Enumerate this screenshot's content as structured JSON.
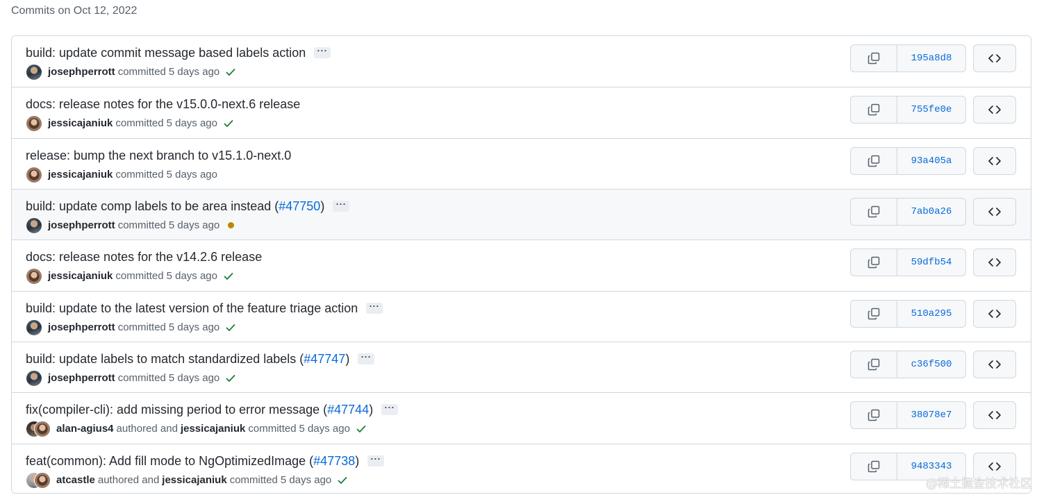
{
  "group_title": "Commits on Oct 12, 2022",
  "icons": {
    "copy": "copy-icon",
    "browse": "code-icon",
    "status_success": "check-icon",
    "status_pending": "pending-dot-icon",
    "more": "ellipsis-icon"
  },
  "colors": {
    "link": "#0969da",
    "success": "#1a7f37",
    "pending": "#bf8700",
    "border": "#d0d7de"
  },
  "commits": [
    {
      "title": "build: update commit message based labels action",
      "pr": "",
      "has_more": true,
      "author": "josephperrott",
      "coauthor": "",
      "authored_word": "",
      "committed_word": "committed",
      "time": "5 days ago",
      "status": "success",
      "sha": "195a8d8",
      "avatars": [
        "male"
      ]
    },
    {
      "title": "docs: release notes for the v15.0.0-next.6 release",
      "pr": "",
      "has_more": false,
      "author": "jessicajaniuk",
      "coauthor": "",
      "authored_word": "",
      "committed_word": "committed",
      "time": "5 days ago",
      "status": "success",
      "sha": "755fe0e",
      "avatars": [
        "female"
      ]
    },
    {
      "title": "release: bump the next branch to v15.1.0-next.0",
      "pr": "",
      "has_more": false,
      "author": "jessicajaniuk",
      "coauthor": "",
      "authored_word": "",
      "committed_word": "committed",
      "time": "5 days ago",
      "status": "",
      "sha": "93a405a",
      "avatars": [
        "female"
      ]
    },
    {
      "title": "build: update comp labels to be area instead (",
      "pr": "#47750",
      "pr_close": ")",
      "has_more": true,
      "author": "josephperrott",
      "coauthor": "",
      "authored_word": "",
      "committed_word": "committed",
      "time": "5 days ago",
      "status": "pending",
      "sha": "7ab0a26",
      "avatars": [
        "male"
      ]
    },
    {
      "title": "docs: release notes for the v14.2.6 release",
      "pr": "",
      "has_more": false,
      "author": "jessicajaniuk",
      "coauthor": "",
      "authored_word": "",
      "committed_word": "committed",
      "time": "5 days ago",
      "status": "success",
      "sha": "59dfb54",
      "avatars": [
        "female"
      ]
    },
    {
      "title": "build: update to the latest version of the feature triage action",
      "pr": "",
      "has_more": true,
      "author": "josephperrott",
      "coauthor": "",
      "authored_word": "",
      "committed_word": "committed",
      "time": "5 days ago",
      "status": "success",
      "sha": "510a295",
      "avatars": [
        "male"
      ]
    },
    {
      "title": "build: update labels to match standardized labels (",
      "pr": "#47747",
      "pr_close": ")",
      "has_more": true,
      "author": "josephperrott",
      "coauthor": "",
      "authored_word": "",
      "committed_word": "committed",
      "time": "5 days ago",
      "status": "success",
      "sha": "c36f500",
      "avatars": [
        "male"
      ]
    },
    {
      "title": "fix(compiler-cli): add missing period to error message (",
      "pr": "#47744",
      "pr_close": ")",
      "has_more": true,
      "author": "alan-agius4",
      "coauthor": "jessicajaniuk",
      "authored_word": "authored and",
      "committed_word": "committed",
      "time": "5 days ago",
      "status": "success",
      "sha": "38078e7",
      "avatars": [
        "alan",
        "female"
      ]
    },
    {
      "title": "feat(common): Add fill mode to NgOptimizedImage (",
      "pr": "#47738",
      "pr_close": ")",
      "has_more": true,
      "author": "atcastle",
      "coauthor": "jessicajaniuk",
      "authored_word": "authored and",
      "committed_word": "committed",
      "time": "5 days ago",
      "status": "success",
      "sha": "9483343",
      "avatars": [
        "atc",
        "female"
      ]
    }
  ],
  "hovered_row": 3,
  "watermark": "@稀土掘金技术社区"
}
